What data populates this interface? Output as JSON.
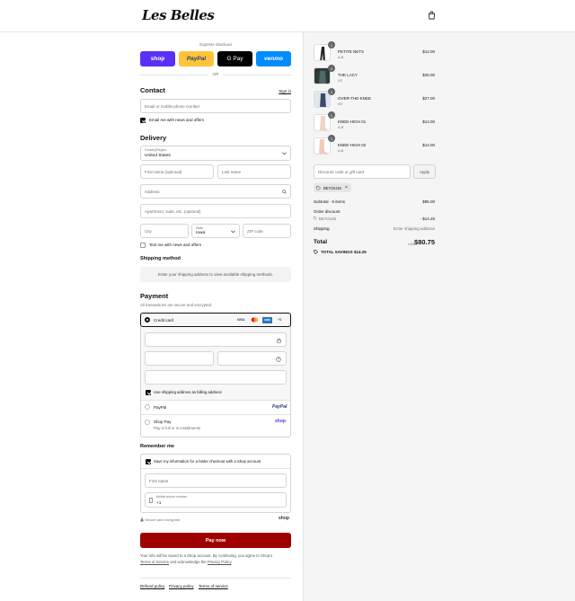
{
  "brand": {
    "logo_text": "Les Belles"
  },
  "express": {
    "label": "Express checkout",
    "buttons": [
      {
        "label": "shop",
        "color": "#5a31f4",
        "text_color": "#ffffff"
      },
      {
        "label": "PayPal",
        "color": "#ffc439",
        "text_color": "#253b80"
      },
      {
        "label": "G Pay",
        "color": "#000000",
        "text_color": "#ffffff"
      },
      {
        "label": "venmo",
        "color": "#008cff",
        "text_color": "#ffffff"
      }
    ],
    "or_label": "OR"
  },
  "contact": {
    "heading": "Contact",
    "sign_in": "Sign in",
    "email_placeholder": "Email or mobile phone number",
    "newsletter_label": "Email me with news and offers",
    "newsletter_checked": true
  },
  "delivery": {
    "heading": "Delivery",
    "country_label": "Country/Region",
    "country_value": "United States",
    "first_name_placeholder": "First name (optional)",
    "last_name_placeholder": "Last name",
    "address_placeholder": "Address",
    "apartment_placeholder": "Apartment, suite, etc. (optional)",
    "city_placeholder": "City",
    "state_label": "State",
    "state_value": "Iowa",
    "zip_placeholder": "ZIP code",
    "text_offers_label": "Text me with news and offers",
    "text_offers_checked": false
  },
  "shipping": {
    "heading": "Shipping method",
    "notice": "Enter your shipping address to view available shipping methods."
  },
  "payment": {
    "heading": "Payment",
    "subtitle": "All transactions are secure and encrypted.",
    "credit_card_label": "Credit card",
    "card_brands": [
      "VISA",
      "MC",
      "AMEX",
      "+5"
    ],
    "billing_same_label": "Use shipping address as billing address",
    "billing_same_checked": true,
    "paypal_label": "PayPal",
    "paypal_logo": "PayPal",
    "shoppay_label": "Shop Pay",
    "shoppay_sub": "Pay in full or in installments",
    "shoppay_logo": "shop"
  },
  "remember": {
    "heading": "Remember me",
    "save_label": "Save my information for a faster checkout with a Shop account",
    "save_checked": true,
    "first_name_placeholder": "First name",
    "phone_label": "Mobile phone number",
    "phone_prefix": "+1",
    "secure_label": "Secure and encrypted",
    "shop_logo": "shop"
  },
  "pay_now": "Pay now",
  "legal": {
    "line1": "Your info will be saved to a Shop account. By continuing, you agree to Shop's",
    "tos": "Terms of Service",
    "and": " and acknowledge the ",
    "privacy": "Privacy Policy",
    "end": "."
  },
  "footer": [
    "Refund policy",
    "Privacy policy",
    "Terms of service"
  ],
  "cart": {
    "items": [
      {
        "name": "PETITE NETS",
        "variant": "A-B",
        "price": "$12.00",
        "qty": "1"
      },
      {
        "name": "THE LACY",
        "variant": "XS",
        "price": "$26.00",
        "qty": "1"
      },
      {
        "name": "OVER-THE-KNEE",
        "variant": "XS",
        "price": "$27.00",
        "qty": "1"
      },
      {
        "name": "KNEE-HIGH 01",
        "variant": "A-B",
        "price": "$14.00",
        "qty": "1"
      },
      {
        "name": "KNEE-HIGH 02",
        "variant": "A-B",
        "price": "$14.00",
        "qty": "1"
      }
    ],
    "discount_placeholder": "Discount code or gift card",
    "apply_label": "Apply",
    "applied_code": "BEYOU15",
    "subtotal_label": "Subtotal · 5 items",
    "subtotal_value": "$95.00",
    "order_discount_label": "Order discount",
    "discount_code": "BEYOU15",
    "discount_value": "- $14.25",
    "shipping_label": "Shipping",
    "shipping_value": "Enter shipping address",
    "total_label": "Total",
    "currency": "USD",
    "total_value": "$80.75",
    "savings_label": "TOTAL SAVINGS",
    "savings_value": "$14.25"
  }
}
